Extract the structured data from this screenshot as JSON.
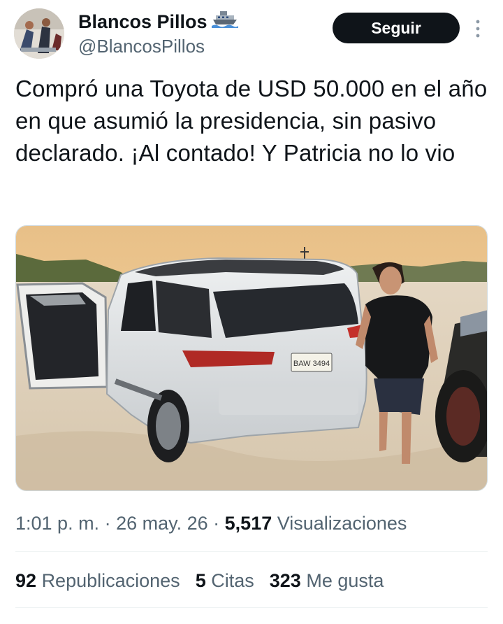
{
  "author": {
    "display_name": "Blancos Pillos",
    "name_emoji_icon": "ship-emoji-icon",
    "handle": "@BlancosPillos"
  },
  "follow_button": {
    "label": "Seguir"
  },
  "tweet": {
    "text": "Compró una Toyota de USD 50.000 en el año en que asumió la presidencia, sin pasivo declarado. ¡Al contado! Y Patricia no lo vio"
  },
  "media": {
    "plate_text": "BAW 3494"
  },
  "meta": {
    "time": "1:01 p. m.",
    "sep1": " · ",
    "date": "26 may. 26",
    "sep2": " · ",
    "views_count": "5,517",
    "views_label": "Visualizaciones"
  },
  "stats": {
    "reposts_count": "92",
    "reposts_label": "Republicaciones",
    "quotes_count": "5",
    "quotes_label": "Citas",
    "likes_count": "323",
    "likes_label": "Me gusta"
  },
  "colors": {
    "text": "#0f1419",
    "secondary": "#536471",
    "button": "#0f1419",
    "divider": "#eff3f4"
  }
}
